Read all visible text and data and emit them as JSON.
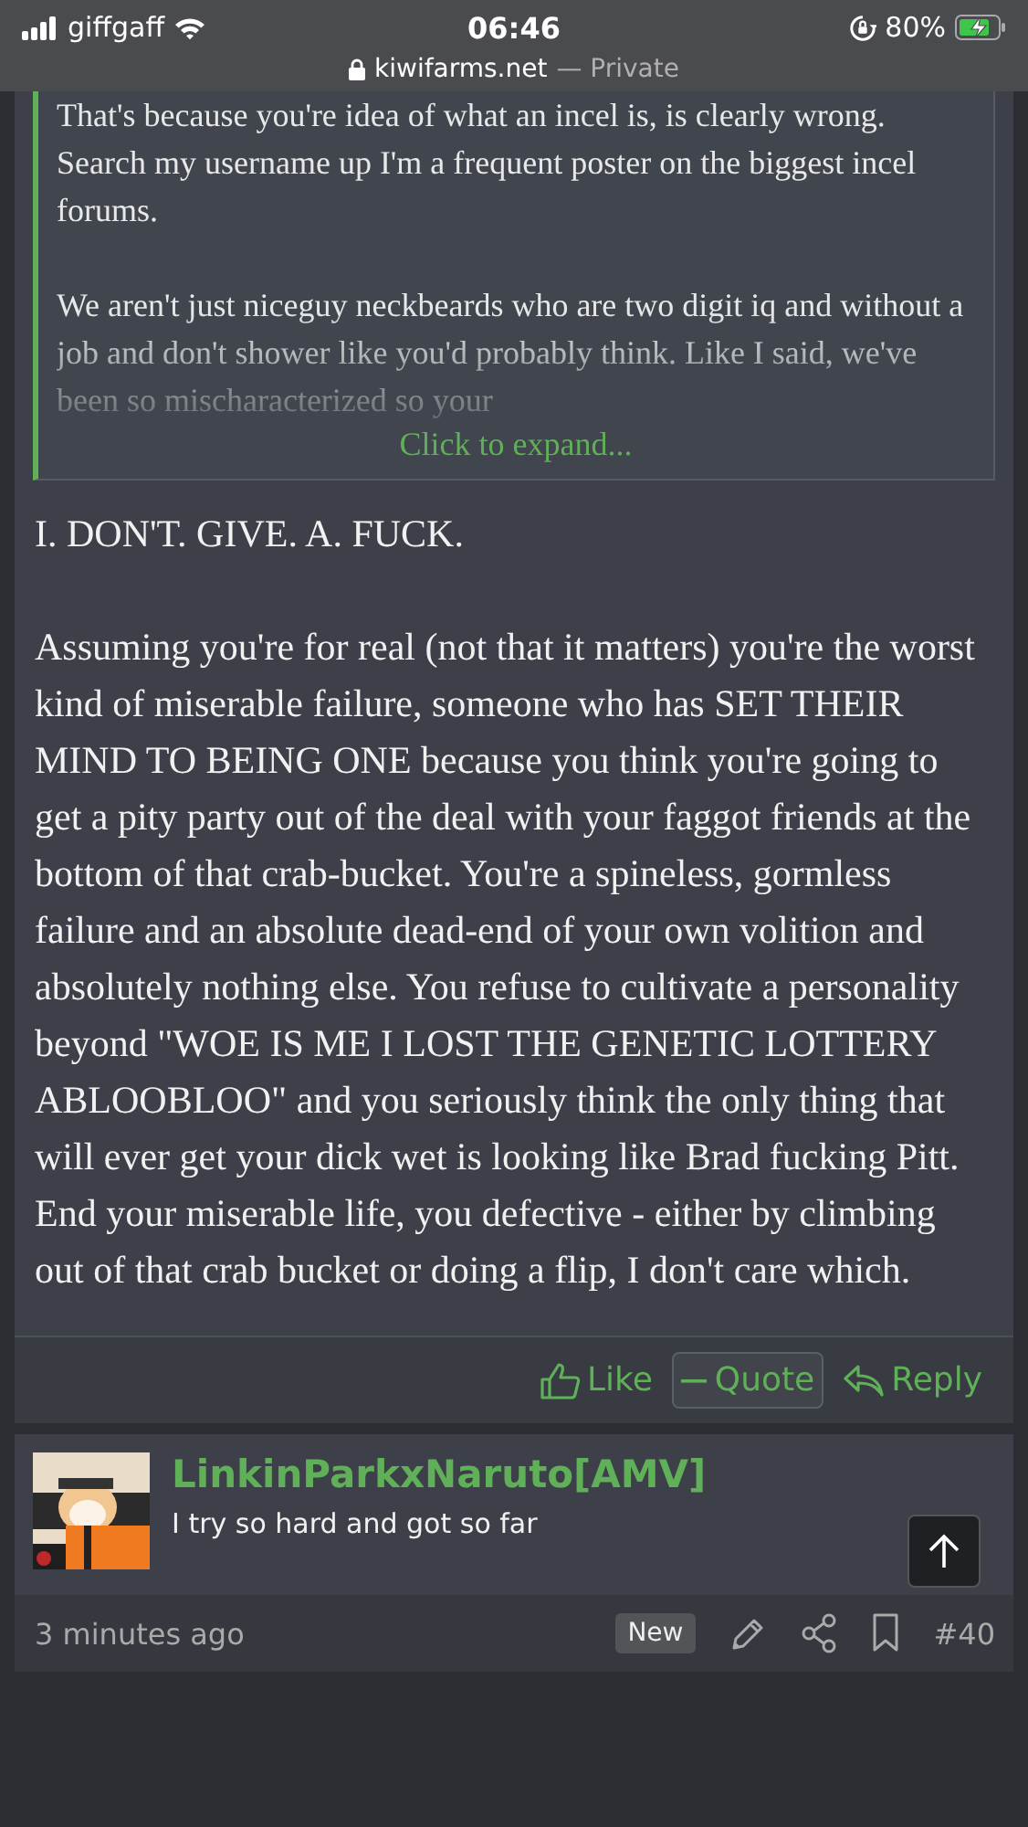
{
  "status_bar": {
    "carrier": "giffgaff",
    "time": "06:46",
    "battery": "80%",
    "url": "kiwifarms.net",
    "mode": "— Private"
  },
  "quote": {
    "paragraphs": [
      "That's because you're idea of what an incel is, is clearly wrong. Search my username up I'm a frequent poster on the biggest incel forums.",
      "We aren't just niceguy neckbeards who are two digit iq and without a job and don't shower like you'd probably think. Like I said, we've been so mischaracterized so your"
    ],
    "expand": "Click to expand..."
  },
  "post": {
    "paragraphs": [
      "I. DON'T. GIVE. A. FUCK.",
      "Assuming you're for real (not that it matters) you're the worst kind of miserable failure, someone who has SET THEIR MIND TO BEING ONE because you think you're going to get a pity party out of the deal with your faggot friends at the bottom of that crab-bucket. You're a spineless, gormless failure and an absolute dead-end of your own volition and absolutely nothing else. You refuse to cultivate a personality beyond \"WOE IS ME I LOST THE GENETIC LOTTERY ABLOOBLOO\" and you seriously think the only thing that will ever get your dick wet is looking like Brad fucking Pitt. End your miserable life, you defective - either by climbing out of that crab bucket or doing a flip, I don't care which."
    ],
    "actions": [
      {
        "label": "Like",
        "kind": "like",
        "selected": false
      },
      {
        "label": "Quote",
        "kind": "quote",
        "selected": true
      },
      {
        "label": "Reply",
        "kind": "reply",
        "selected": false
      }
    ]
  },
  "next_post": {
    "username": "LinkinParkxNaruto[AMV]",
    "user_title": "I try so hard and got so far",
    "time": "3 minutes ago",
    "badge": "New",
    "number": "#40"
  }
}
